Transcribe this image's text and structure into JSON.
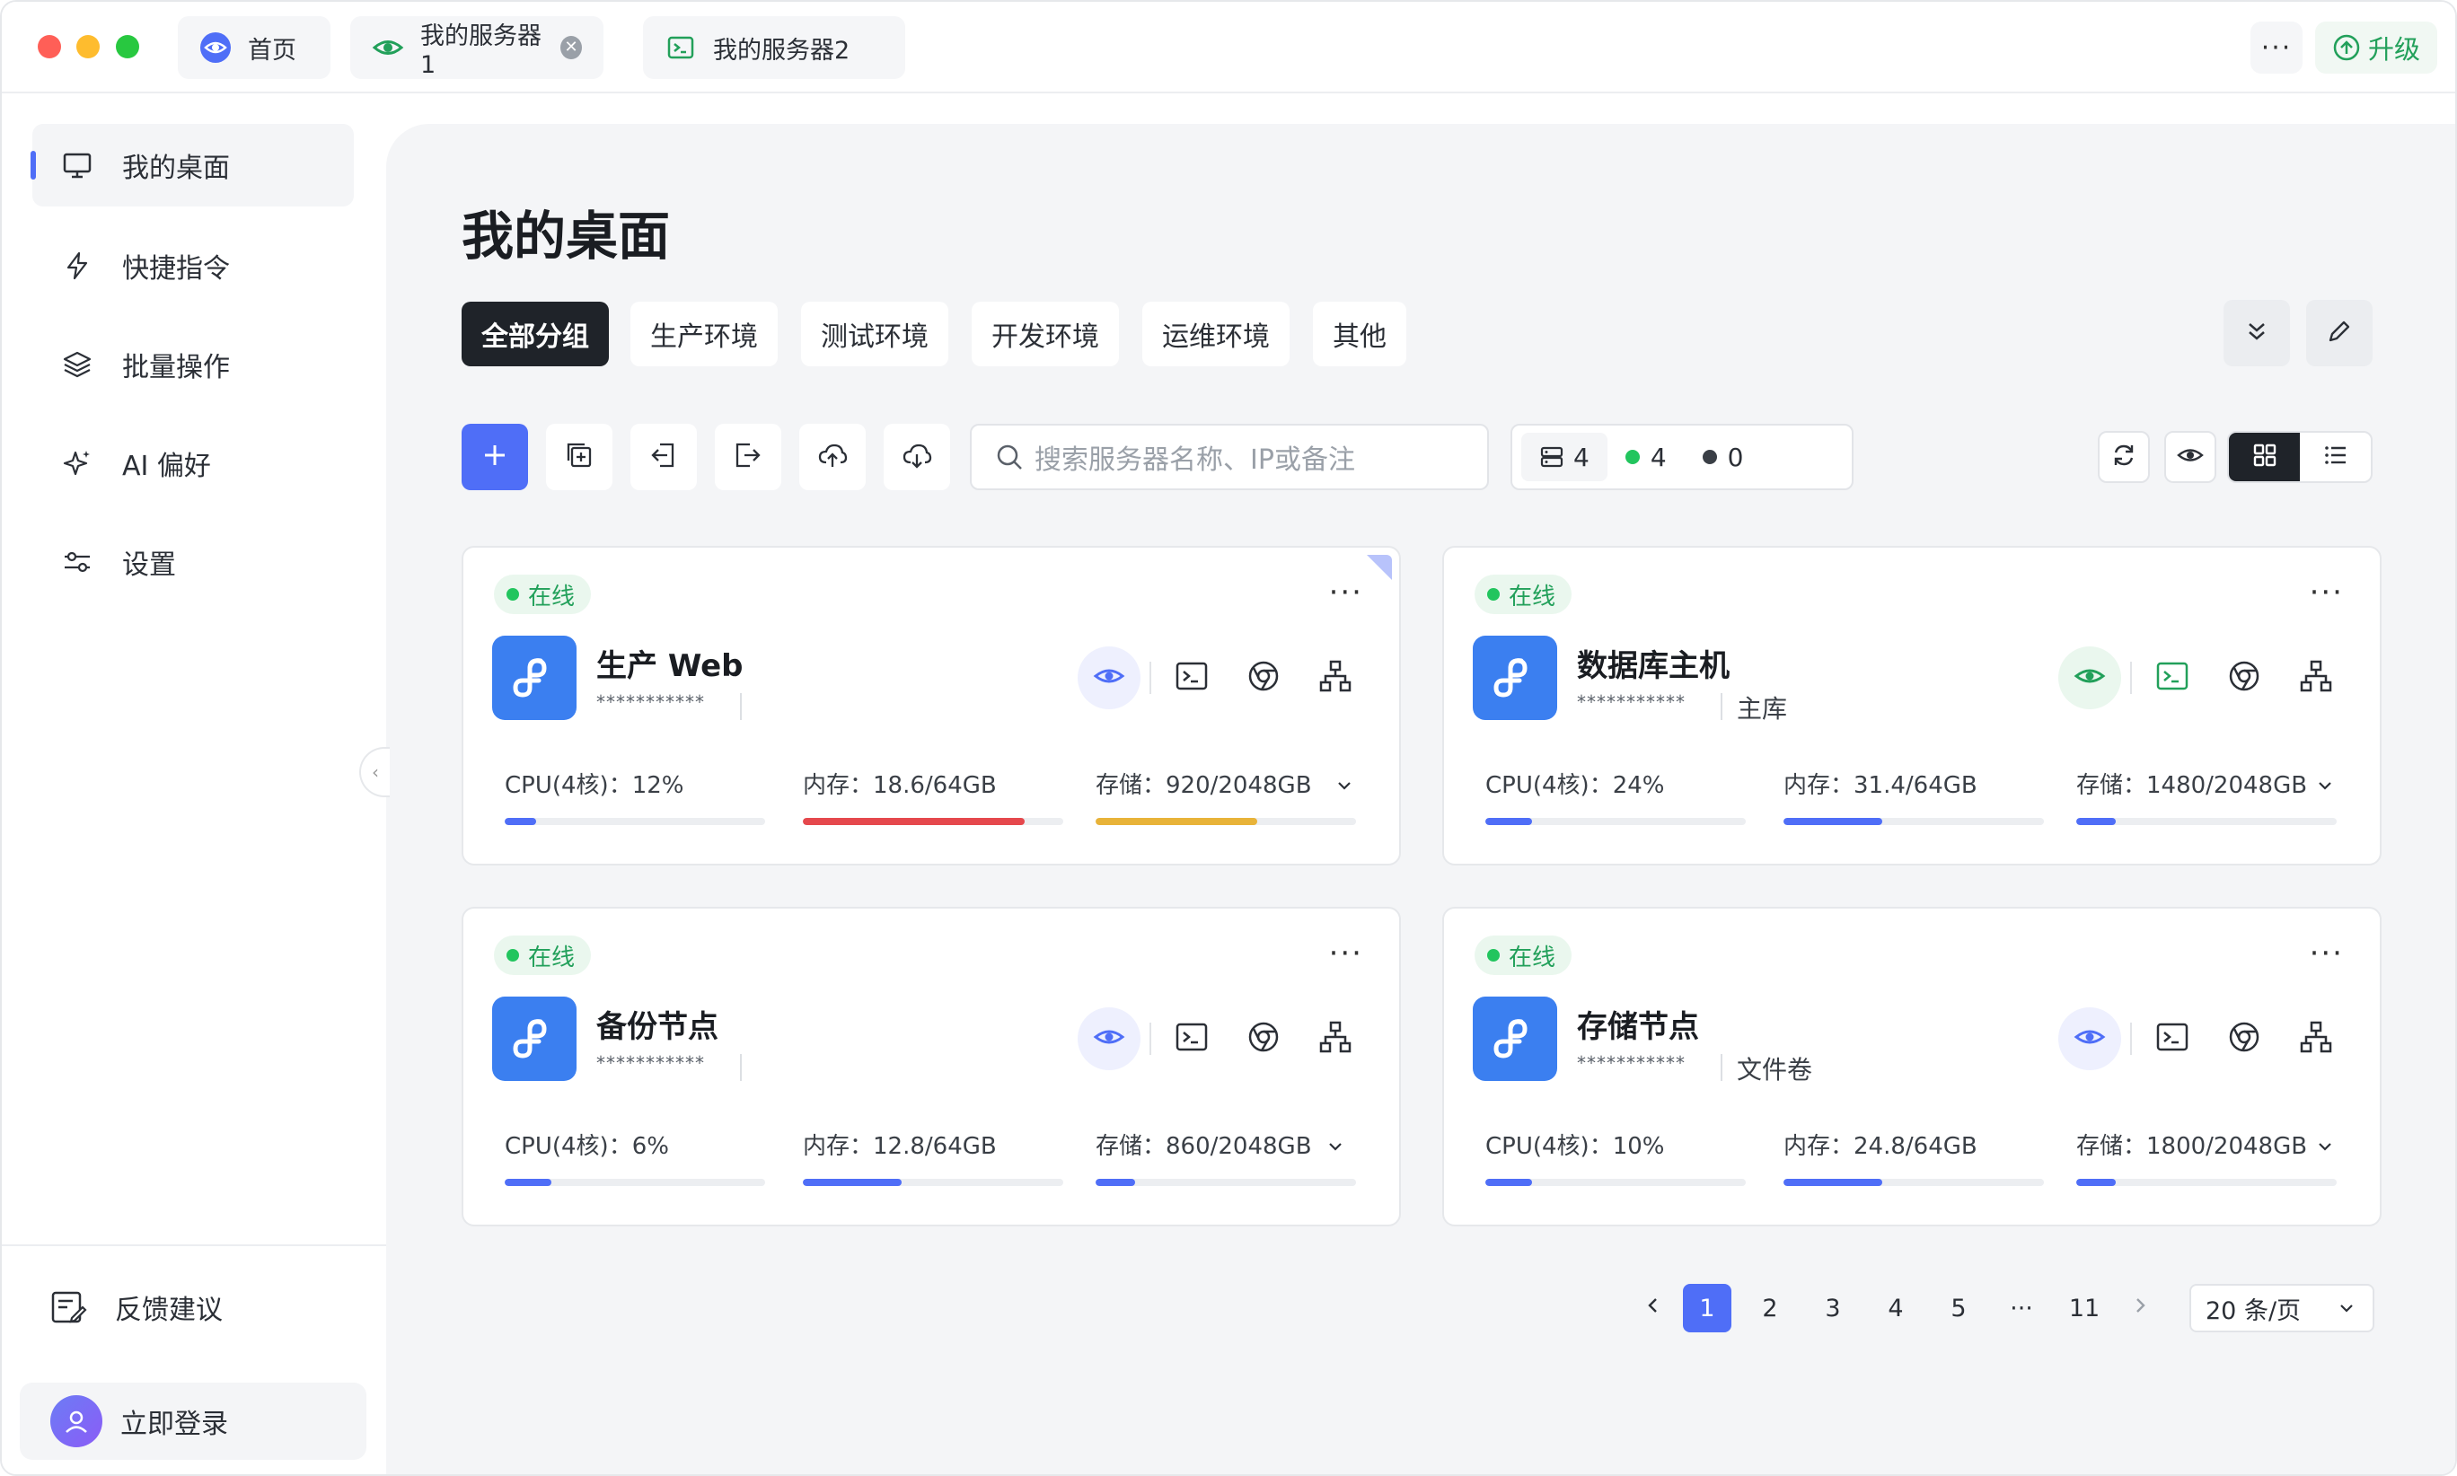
{
  "window": {
    "tabs": [
      {
        "label": "首页",
        "icon": "eye-logo-icon",
        "closable": false
      },
      {
        "label": "我的服务器1",
        "icon": "eye-green-icon",
        "closable": true
      },
      {
        "label": "我的服务器2",
        "icon": "terminal-icon",
        "closable": false
      }
    ],
    "more_label": "···",
    "upgrade_label": "升级"
  },
  "sidebar": {
    "items": [
      {
        "label": "我的桌面",
        "icon": "monitor-icon",
        "active": true
      },
      {
        "label": "快捷指令",
        "icon": "lightning-icon",
        "active": false
      },
      {
        "label": "批量操作",
        "icon": "layers-icon",
        "active": false
      },
      {
        "label": "AI 偏好",
        "icon": "sparkle-icon",
        "active": false
      },
      {
        "label": "设置",
        "icon": "sliders-icon",
        "active": false
      }
    ],
    "feedback_label": "反馈建议",
    "login_label": "立即登录"
  },
  "main": {
    "title": "我的桌面",
    "groups": [
      "全部分组",
      "生产环境",
      "测试环境",
      "开发环境",
      "运维环境",
      "其他"
    ],
    "active_group": "全部分组",
    "search_placeholder": "搜索服务器名称、IP或备注",
    "stats": {
      "total": "4",
      "online": "4",
      "offline": "0"
    },
    "view_mode": "grid"
  },
  "servers": [
    {
      "status": "在线",
      "name": "生产 Web",
      "masked": "***********",
      "note": "",
      "cpu_label": "CPU(4核)：12%",
      "cpu": 0.12,
      "mem_label": "内存：18.6/64GB",
      "mem": 0.85,
      "disk_label": "存储：920/2048GB",
      "disk": 0.62,
      "mem_color": "#e5484d",
      "disk_color": "#e8b339",
      "eye_green": false,
      "terminal_green": false
    },
    {
      "status": "在线",
      "name": "数据库主机",
      "masked": "***********",
      "note": "主库",
      "cpu_label": "CPU(4核)：24%",
      "cpu": 0.18,
      "mem_label": "内存：31.4/64GB",
      "mem": 0.38,
      "disk_label": "存储：1480/2048GB",
      "disk": 0.15,
      "mem_color": "#4f6ef7",
      "disk_color": "#4f6ef7",
      "eye_green": true,
      "terminal_green": true
    },
    {
      "status": "在线",
      "name": "备份节点",
      "masked": "***********",
      "note": "",
      "cpu_label": "CPU(4核)：6%",
      "cpu": 0.18,
      "mem_label": "内存：12.8/64GB",
      "mem": 0.38,
      "disk_label": "存储：860/2048GB",
      "disk": 0.15,
      "mem_color": "#4f6ef7",
      "disk_color": "#4f6ef7",
      "eye_green": false,
      "terminal_green": false
    },
    {
      "status": "在线",
      "name": "存储节点",
      "masked": "***********",
      "note": "文件卷",
      "cpu_label": "CPU(4核)：10%",
      "cpu": 0.18,
      "mem_label": "内存：24.8/64GB",
      "mem": 0.38,
      "disk_label": "存储：1800/2048GB",
      "disk": 0.15,
      "mem_color": "#4f6ef7",
      "disk_color": "#4f6ef7",
      "eye_green": false,
      "terminal_green": false
    }
  ],
  "pagination": {
    "pages": [
      "1",
      "2",
      "3",
      "4",
      "5",
      "···",
      "11"
    ],
    "current": "1",
    "page_size_label": "20 条/页"
  },
  "colors": {
    "accent": "#4f6ef7",
    "online": "#22c55e",
    "dark": "#1f2329",
    "logo_bg": "#3b7ff0"
  }
}
